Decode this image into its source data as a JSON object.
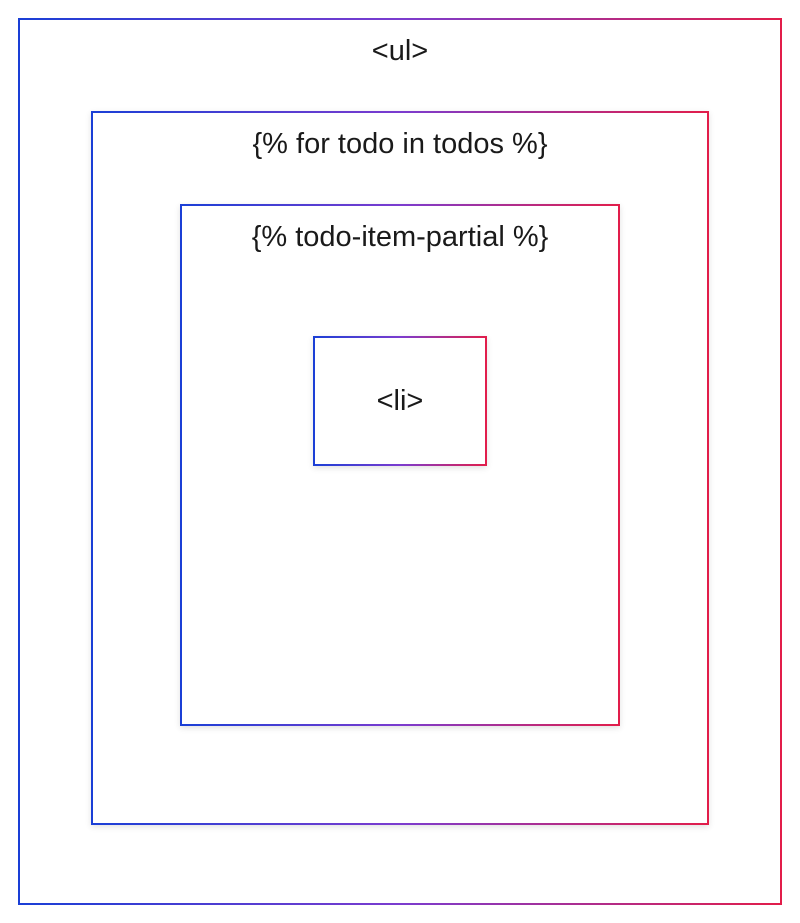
{
  "diagram": {
    "outer_label": "<ul>",
    "loop_label": "{% for todo in todos %}",
    "partial_label": "{% todo-item-partial %}",
    "inner_label": "<li>"
  }
}
